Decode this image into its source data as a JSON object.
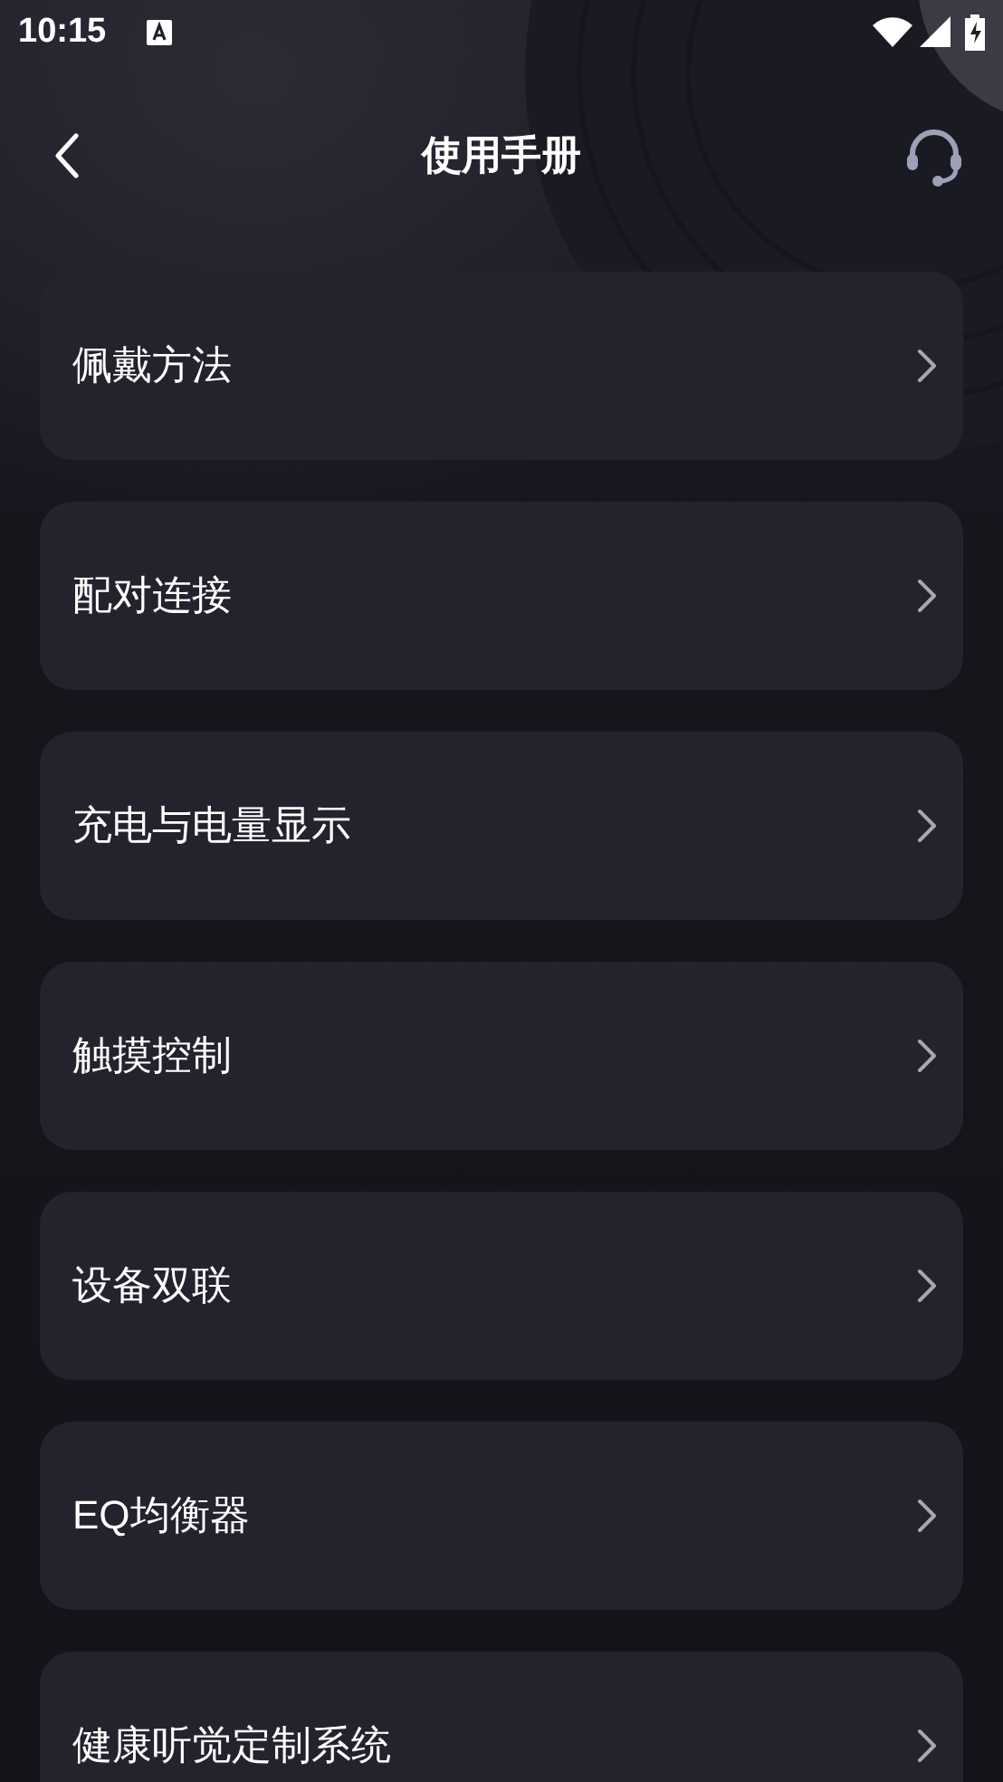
{
  "status_bar": {
    "time": "10:15"
  },
  "header": {
    "title": "使用手册"
  },
  "items": [
    {
      "label": "佩戴方法"
    },
    {
      "label": "配对连接"
    },
    {
      "label": "充电与电量显示"
    },
    {
      "label": "触摸控制"
    },
    {
      "label": "设备双联"
    },
    {
      "label": "EQ均衡器"
    },
    {
      "label": "健康听觉定制系统"
    }
  ]
}
